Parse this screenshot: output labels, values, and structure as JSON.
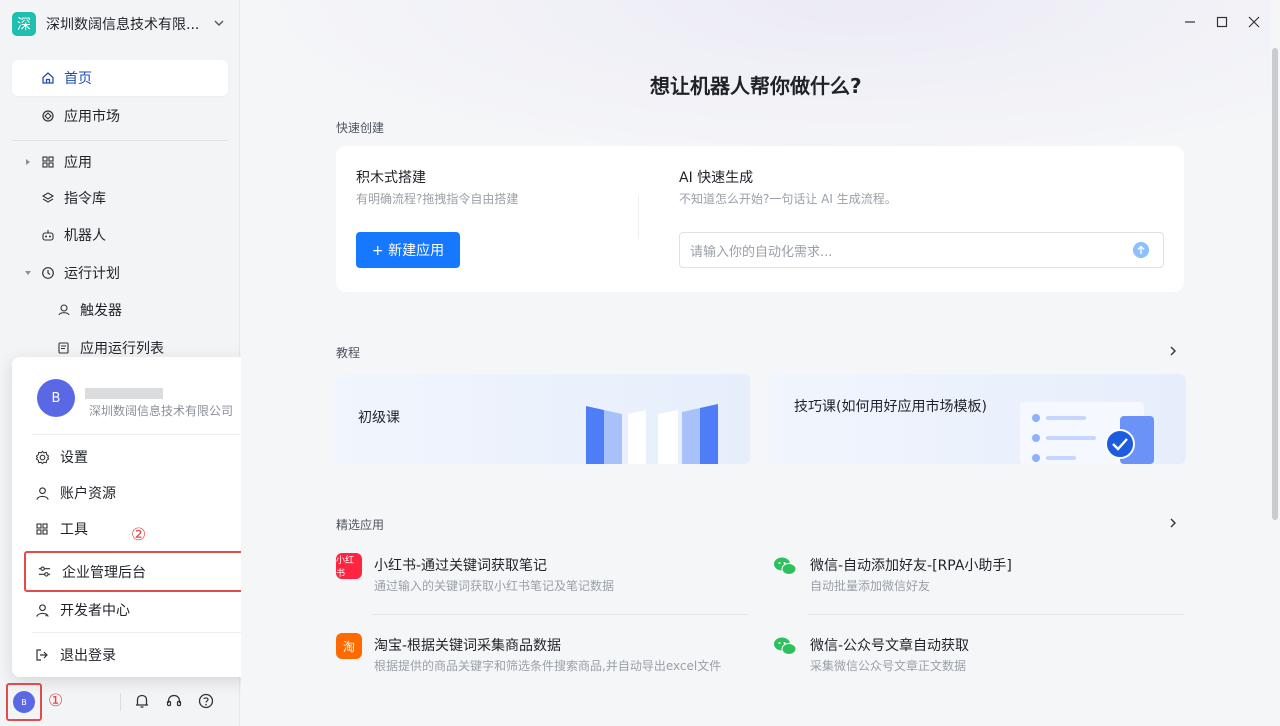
{
  "sidebar": {
    "org_logo": "深",
    "org_name": "深圳数阔信息技术有限...",
    "items": [
      {
        "label": "首页",
        "icon": "home-icon"
      },
      {
        "label": "应用市场",
        "icon": "market-icon"
      },
      {
        "label": "应用",
        "icon": "grid-icon"
      },
      {
        "label": "指令库",
        "icon": "layers-icon"
      },
      {
        "label": "机器人",
        "icon": "robot-icon"
      },
      {
        "label": "运行计划",
        "icon": "clock-icon"
      },
      {
        "label": "触发器",
        "icon": "trigger-icon"
      },
      {
        "label": "应用运行列表",
        "icon": "list-icon"
      }
    ]
  },
  "popup": {
    "avatar": "B",
    "company": "深圳数阔信息技术有限公司",
    "items": [
      {
        "label": "设置"
      },
      {
        "label": "账户资源"
      },
      {
        "label": "工具"
      },
      {
        "label": "企业管理后台"
      },
      {
        "label": "开发者中心"
      },
      {
        "label": "退出登录"
      }
    ]
  },
  "annotations": {
    "one": "①",
    "two": "②"
  },
  "bottom": {
    "avatar": "B"
  },
  "main": {
    "headline": "想让机器人帮你做什么?",
    "quick_create_label": "快速创建",
    "block_title": "积木式搭建",
    "block_desc": "有明确流程?拖拽指令自由搭建",
    "new_app_button": "+ 新建应用",
    "ai_title": "AI 快速生成",
    "ai_desc": "不知道怎么开始?一句话让 AI 生成流程。",
    "ai_placeholder": "请输入你的自动化需求...",
    "tutorial_label": "教程",
    "tutorials": [
      {
        "title": "初级课"
      },
      {
        "title": "技巧课(如何用好应用市场模板)"
      }
    ],
    "featured_label": "精选应用",
    "apps": [
      {
        "logo": "小红书",
        "title": "小红书-通过关键词获取笔记",
        "desc": "通过输入的关键词获取小红书笔记及笔记数据",
        "color": "#ff2442"
      },
      {
        "logo": "微",
        "title": "微信-自动添加好友-[RPA小助手]",
        "desc": "自动批量添加微信好友",
        "color": "#2fbf5f"
      },
      {
        "logo": "淘",
        "title": "淘宝-根据关键词采集商品数据",
        "desc": "根据提供的商品关键字和筛选条件搜索商品,并自动导出excel文件",
        "color": "#ff6a00"
      },
      {
        "logo": "微",
        "title": "微信-公众号文章自动获取",
        "desc": "采集微信公众号文章正文数据",
        "color": "#2fbf5f"
      }
    ]
  }
}
